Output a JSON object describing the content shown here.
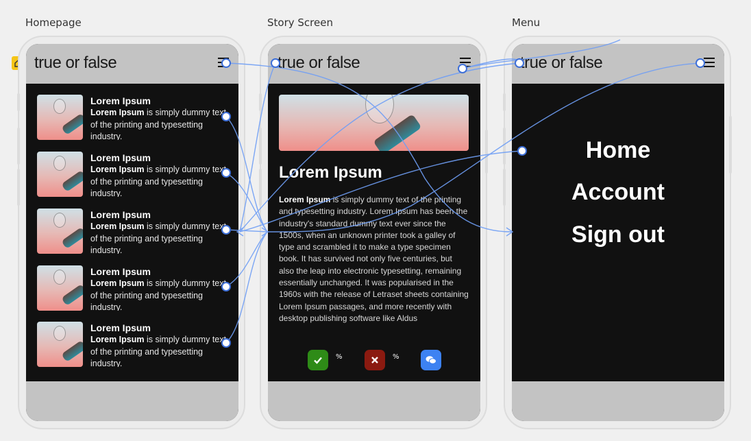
{
  "frames": {
    "homepage": "Homepage",
    "story": "Story Screen",
    "menu": "Menu"
  },
  "brand": "true or false",
  "homepage_items": [
    {
      "title": "Lorem Ipsum",
      "body_bold": "Lorem Ipsum",
      "body": " is simply dummy text of the printing and typesetting industry."
    },
    {
      "title": "Lorem Ipsum",
      "body_bold": "Lorem Ipsum",
      "body": " is simply dummy text of the printing and typesetting industry."
    },
    {
      "title": "Lorem Ipsum",
      "body_bold": "Lorem Ipsum",
      "body": " is simply dummy text of the printing and typesetting industry."
    },
    {
      "title": "Lorem Ipsum",
      "body_bold": "Lorem Ipsum",
      "body": " is simply dummy text of the printing and typesetting industry."
    },
    {
      "title": "Lorem Ipsum",
      "body_bold": "Lorem Ipsum",
      "body": " is simply dummy text of the printing and typesetting industry."
    }
  ],
  "story": {
    "title": "Lorem Ipsum",
    "body_bold": "Lorem Ipsum",
    "body": " is simply dummy text of the printing and typesetting industry. Lorem Ipsum has been the industry's standard dummy text ever since the 1500s, when an unknown printer took a galley of type and scrambled it to make a type specimen book. It has survived not only five centuries, but also the leap into electronic typesetting, remaining essentially unchanged. It was popularised in the 1960s with the release of Letraset sheets containing Lorem Ipsum passages, and more recently with desktop publishing software like Aldus",
    "true_pct": "%",
    "false_pct": "%",
    "colors": {
      "true": "#2e8b17",
      "false": "#8b1a10",
      "comment": "#3d82f2"
    }
  },
  "menu": {
    "items": [
      "Home",
      "Account",
      "Sign out"
    ]
  },
  "colors": {
    "bar": "#c3c3c3",
    "screen": "#111111",
    "wire": "#6f9ef5",
    "flag": "#f5c518"
  },
  "icons": {
    "start": "home-icon",
    "menu": "hamburger-icon",
    "true": "check-icon",
    "false": "x-icon",
    "comment": "chat-bubble-icon"
  }
}
